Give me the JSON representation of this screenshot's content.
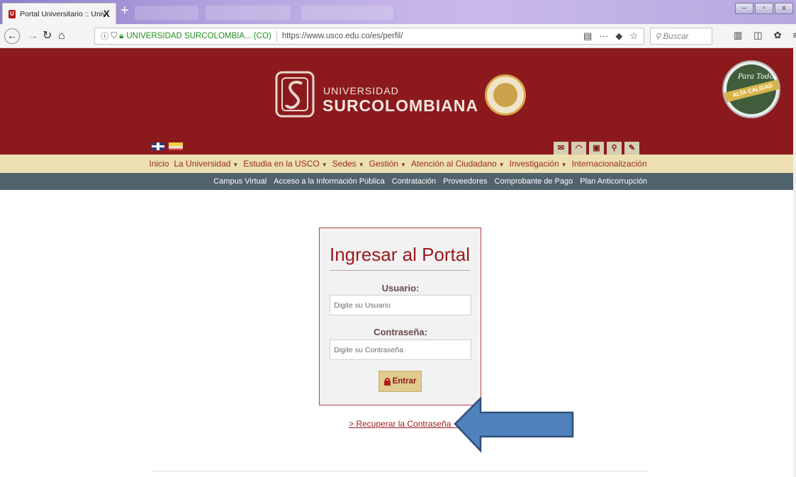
{
  "browser": {
    "tab_title": "Portal Universitario :: Universid",
    "tab_close": "X",
    "new_tab": "+",
    "site_identity": "UNIVERSIDAD SURCOLOMBIA... (CO)",
    "url": "https://www.usco.edu.co/es/perfil/",
    "search_placeholder": "Buscar",
    "window_controls": [
      "–",
      "▫",
      "x"
    ]
  },
  "header": {
    "name_line1": "UNIVERSIDAD",
    "name_line2": "SURCOLOMBIANA",
    "accreditation_band": "ALTA CALIDAD",
    "accreditation_script": "Para Todos",
    "brand_color": "#8c1a1d"
  },
  "main_menu": [
    {
      "label": "Inicio",
      "dropdown": false
    },
    {
      "label": "La Universidad",
      "dropdown": true
    },
    {
      "label": "Estudia en la USCO",
      "dropdown": true
    },
    {
      "label": "Sedes",
      "dropdown": true
    },
    {
      "label": "Gestión",
      "dropdown": true
    },
    {
      "label": "Atención al Ciudadano",
      "dropdown": true
    },
    {
      "label": "Investigación",
      "dropdown": true
    },
    {
      "label": "Internacionalización",
      "dropdown": false
    }
  ],
  "sub_menu": [
    "Campus Virtual",
    "Acceso a la Información Pública",
    "Contratación",
    "Proveedores",
    "Comprobante de Pago",
    "Plan Anticorrupción"
  ],
  "login": {
    "title": "Ingresar al Portal",
    "user_label": "Usuario:",
    "user_placeholder": "Digite su Usuario",
    "password_label": "Contraseña:",
    "password_placeholder": "Digite su Contraseña",
    "submit_label": "Entrar",
    "recover_link": "> Recuperar la Contraseña <"
  },
  "annotation": {
    "arrow_color": "#4f81bd"
  }
}
